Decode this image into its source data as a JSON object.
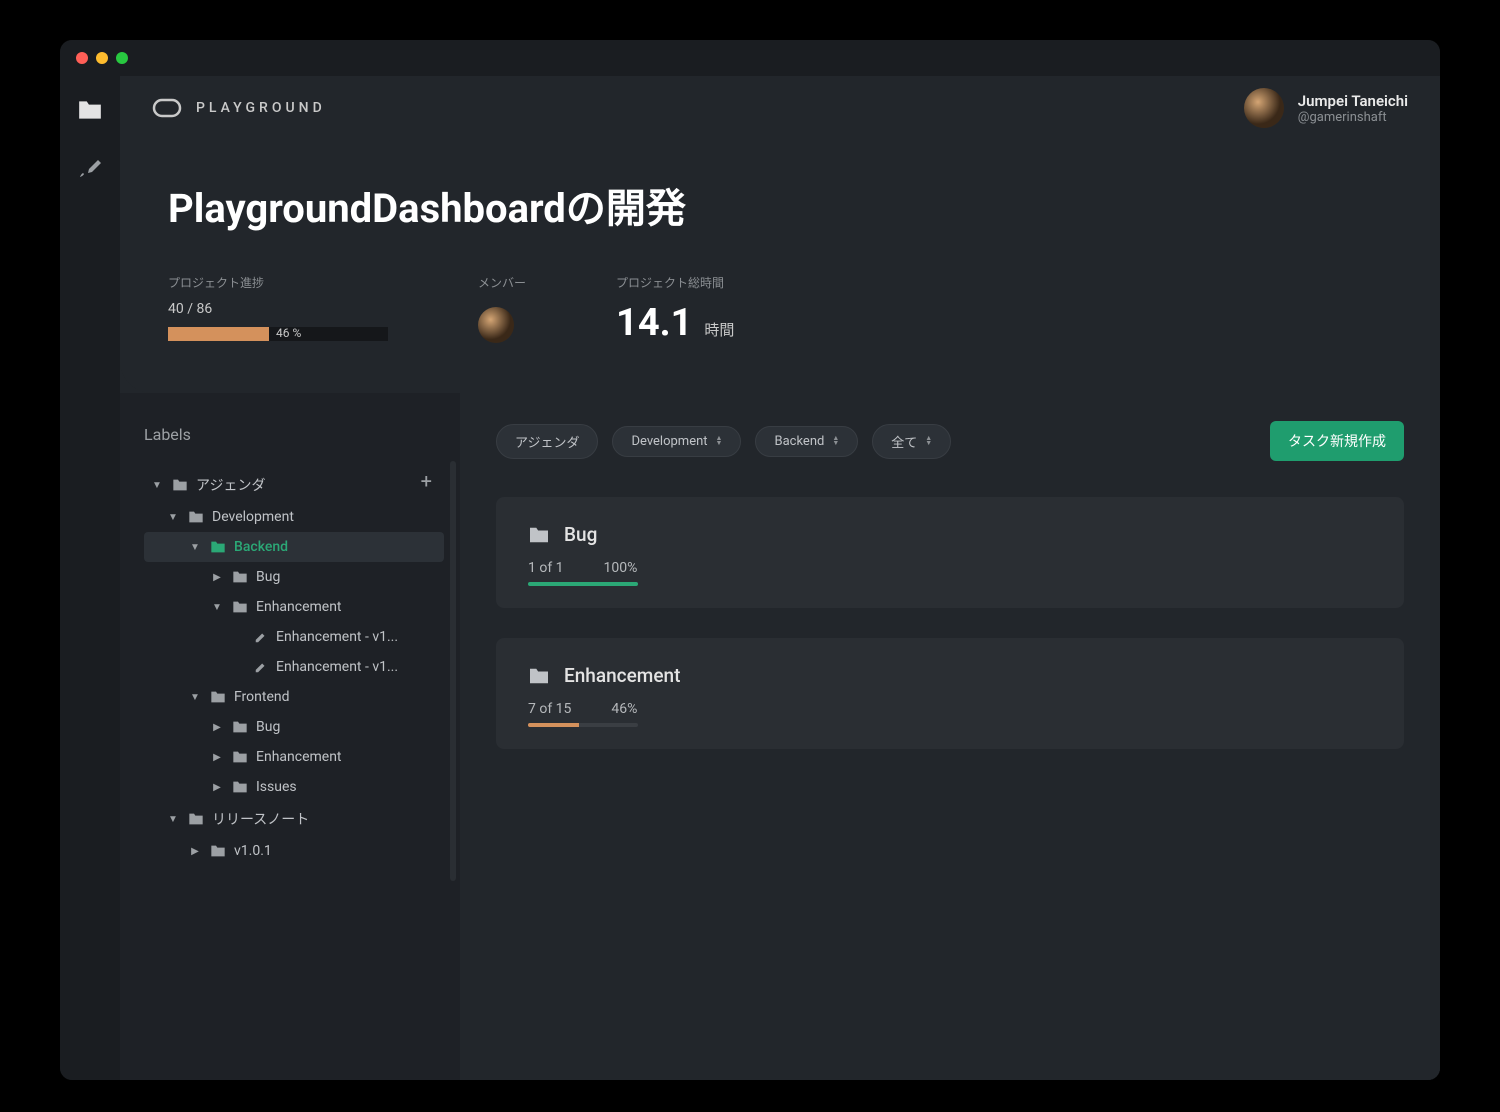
{
  "brand": "PLAYGROUND",
  "user": {
    "name": "Jumpei Taneichi",
    "handle": "@gamerinshaft"
  },
  "page_title": "PlaygroundDashboardの開発",
  "stats": {
    "progress_label": "プロジェクト進捗",
    "progress_count": "40 / 86",
    "progress_pct": "46 %",
    "progress_value": 46,
    "members_label": "メンバー",
    "time_label": "プロジェクト総時間",
    "time_value": "14.1",
    "time_unit": "時間"
  },
  "sidebar": {
    "title": "Labels",
    "tree": {
      "agenda": "アジェンダ",
      "development": "Development",
      "backend": "Backend",
      "bug": "Bug",
      "enhancement": "Enhancement",
      "enh_v1_a": "Enhancement - v1...",
      "enh_v1_b": "Enhancement - v1...",
      "frontend": "Frontend",
      "bug2": "Bug",
      "enhancement2": "Enhancement",
      "issues": "Issues",
      "release_notes": "リリースノート",
      "v101": "v1.0.1"
    }
  },
  "filters": {
    "agenda": "アジェンダ",
    "development": "Development",
    "backend": "Backend",
    "all": "全て"
  },
  "create_button": "タスク新規作成",
  "cards": [
    {
      "title": "Bug",
      "count": "1 of 1",
      "pct": "100%",
      "value": 100,
      "color": "green"
    },
    {
      "title": "Enhancement",
      "count": "7 of 15",
      "pct": "46%",
      "value": 46,
      "color": "orange"
    }
  ]
}
